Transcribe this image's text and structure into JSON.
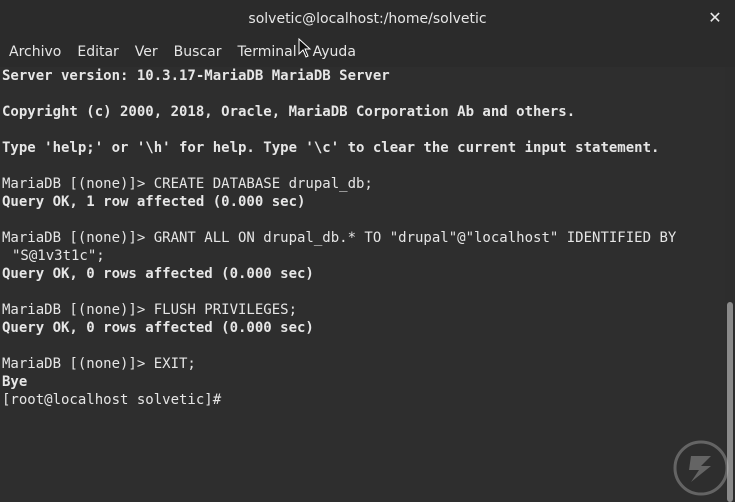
{
  "window": {
    "title": "solvetic@localhost:/home/solvetic"
  },
  "menu": [
    "Archivo",
    "Editar",
    "Ver",
    "Buscar",
    "Terminal",
    "Ayuda"
  ],
  "terminal": {
    "lines": [
      {
        "text": "Server version: 10.3.17-MariaDB MariaDB Server",
        "bold": true
      },
      {
        "text": "",
        "bold": false
      },
      {
        "text": "Copyright (c) 2000, 2018, Oracle, MariaDB Corporation Ab and others.",
        "bold": true
      },
      {
        "text": "",
        "bold": false
      },
      {
        "text": "Type 'help;' or '\\h' for help. Type '\\c' to clear the current input statement.",
        "bold": true
      },
      {
        "text": "",
        "bold": false
      },
      {
        "text": "MariaDB [(none)]> CREATE DATABASE drupal_db;",
        "bold": false
      },
      {
        "text": "Query OK, 1 row affected (0.000 sec)",
        "bold": true
      },
      {
        "text": "",
        "bold": false
      },
      {
        "text": "MariaDB [(none)]> GRANT ALL ON drupal_db.* TO \"drupal\"@\"localhost\" IDENTIFIED BY",
        "bold": false
      },
      {
        "text": "\"S@1v3t1c\";",
        "bold": false,
        "cont": true
      },
      {
        "text": "Query OK, 0 rows affected (0.000 sec)",
        "bold": true
      },
      {
        "text": "",
        "bold": false
      },
      {
        "text": "MariaDB [(none)]> FLUSH PRIVILEGES;",
        "bold": false
      },
      {
        "text": "Query OK, 0 rows affected (0.000 sec)",
        "bold": true
      },
      {
        "text": "",
        "bold": false
      },
      {
        "text": "MariaDB [(none)]> EXIT;",
        "bold": false
      },
      {
        "text": "Bye",
        "bold": true
      },
      {
        "text": "[root@localhost solvetic]# ",
        "bold": false,
        "prompt": true
      }
    ]
  },
  "icons": {
    "close": "close-icon",
    "pointer": "mouse-pointer-icon",
    "watermark": "solvetic-logo"
  }
}
